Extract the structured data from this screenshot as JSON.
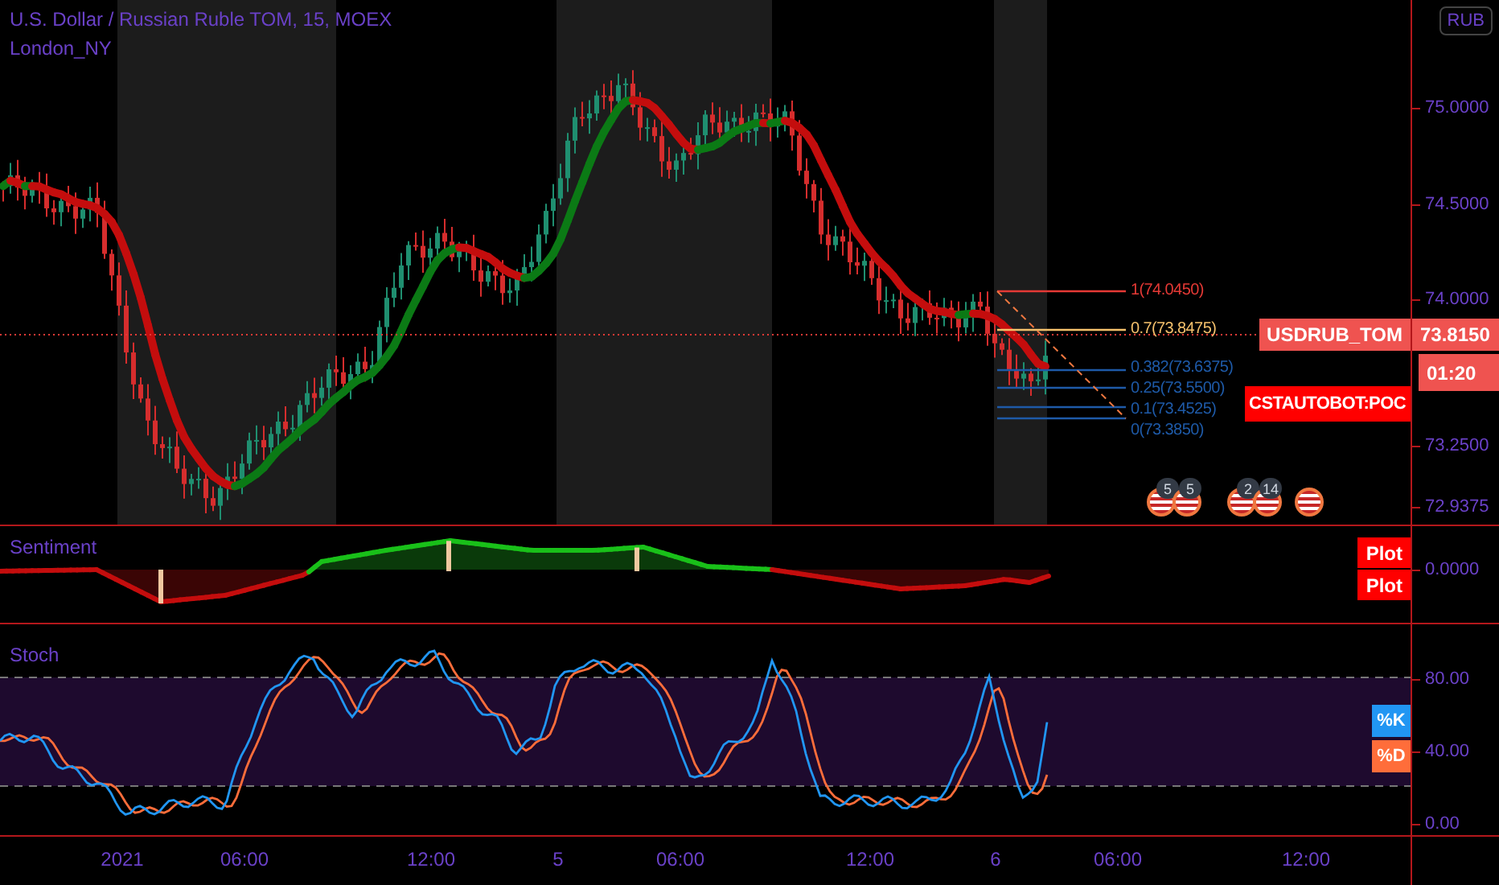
{
  "header": {
    "title": "U.S. Dollar / Russian Ruble TOM, 15, MOEX",
    "indicator": "London_NY"
  },
  "main_pane": {
    "currency_badge": "RUB",
    "price_axis": [
      "75.0000",
      "74.5000",
      "74.0000",
      "73.2500",
      "72.9375"
    ],
    "fib_levels": [
      {
        "label": "1(74.0450)",
        "color": "#e53935"
      },
      {
        "label": "0.7(73.8475)",
        "color": "#f5c16c"
      },
      {
        "label": "0.382(73.6375)",
        "color": "#1e5aa8"
      },
      {
        "label": "0.25(73.5500)",
        "color": "#1e5aa8"
      },
      {
        "label": "0.1(73.4525)",
        "color": "#1e5aa8"
      },
      {
        "label": "0(73.3850)",
        "color": "#1e5aa8"
      }
    ],
    "last_price": {
      "symbol": "USDRUB_TOM",
      "price": "73.8150",
      "countdown": "01:20"
    },
    "poc_label": "CSTAUTOBOT:POC",
    "events": [
      {
        "kind": "badged",
        "count": "5"
      },
      {
        "kind": "badged",
        "count": "5"
      },
      {
        "kind": "badged",
        "count": "2"
      },
      {
        "kind": "badged",
        "count": "14"
      },
      {
        "kind": "plain"
      }
    ]
  },
  "sentiment_pane": {
    "title": "Sentiment",
    "plot_labels": [
      "Plot",
      "Plot"
    ],
    "axis": [
      "0.0000"
    ]
  },
  "stoch_pane": {
    "title": "Stoch",
    "legend": [
      {
        "label": "%K",
        "color": "#2196f3"
      },
      {
        "label": "%D",
        "color": "#ff6d3a"
      }
    ],
    "axis": [
      "80.00",
      "40.00",
      "0.00"
    ]
  },
  "time_axis": [
    "2021",
    "06:00",
    "12:00",
    "5",
    "06:00",
    "12:00",
    "6",
    "06:00",
    "12:00"
  ]
}
